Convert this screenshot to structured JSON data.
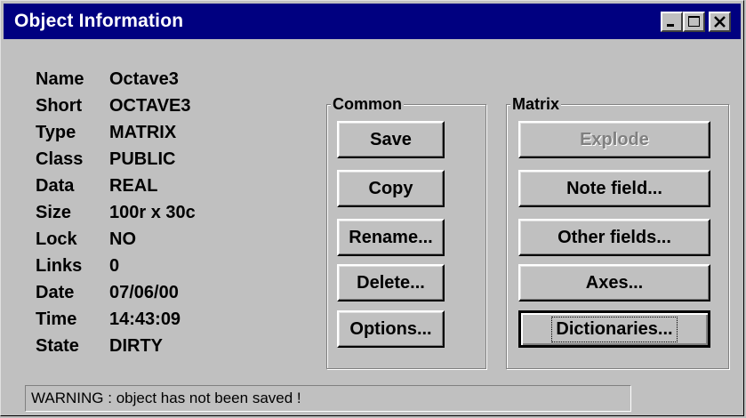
{
  "window": {
    "title": "Object Information"
  },
  "info": [
    {
      "label": "Name",
      "value": "Octave3"
    },
    {
      "label": "Short",
      "value": "OCTAVE3"
    },
    {
      "label": "Type",
      "value": "MATRIX"
    },
    {
      "label": "Class",
      "value": "PUBLIC"
    },
    {
      "label": "Data",
      "value": "REAL"
    },
    {
      "label": "Size",
      "value": "100r x 30c"
    },
    {
      "label": "Lock",
      "value": "NO"
    },
    {
      "label": "Links",
      "value": "0"
    },
    {
      "label": "Date",
      "value": "07/06/00"
    },
    {
      "label": "Time",
      "value": "14:43:09"
    },
    {
      "label": "State",
      "value": "DIRTY"
    }
  ],
  "common": {
    "title": "Common",
    "buttons": [
      "Save",
      "Copy",
      "Rename...",
      "Delete...",
      "Options..."
    ]
  },
  "matrix": {
    "title": "Matrix",
    "buttons": [
      "Explode",
      "Note field...",
      "Other fields...",
      "Axes...",
      "Dictionaries..."
    ]
  },
  "status": {
    "text": "WARNING : object has not been saved !"
  },
  "icons": {
    "minimize": "minimize-icon",
    "maximize": "maximize-icon",
    "close": "close-icon"
  }
}
